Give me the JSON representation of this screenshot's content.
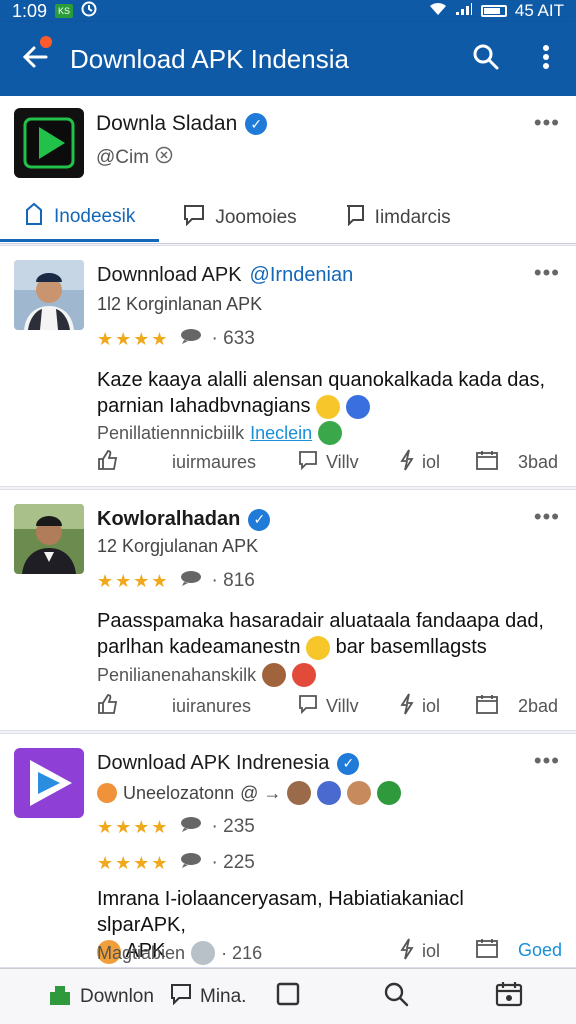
{
  "status_bar": {
    "time": "1:09",
    "badge": "KS",
    "battery_text": "45 AIT"
  },
  "app_bar": {
    "title": "Download APK Indensia"
  },
  "profile": {
    "name": "Downla Sladan",
    "handle": "@Cim",
    "more": "•••"
  },
  "tabs": [
    {
      "label": "Inodeesik",
      "icon": "bookmark-icon"
    },
    {
      "label": "Joomoies",
      "icon": "comment-icon"
    },
    {
      "label": "Iimdarcis",
      "icon": "flag-icon"
    }
  ],
  "posts": [
    {
      "title": "Downnload APK",
      "mention": "@Irndenian",
      "subtitle": "1l2 Korginlanan APK",
      "rating_count": "· 633",
      "body": "Kaze kaaya alalli alensan quanokalkada kada das, parnian Iahadbvnagians",
      "meta": "Penillatiennnicbiilk",
      "meta_link": "Ineclein",
      "actions": {
        "reply": "iuirmaures",
        "views": "Villv",
        "share": "iol",
        "save": "3bad"
      }
    },
    {
      "title": "Kowloralhadan",
      "subtitle": "12 Korgjulanan APK",
      "rating_count": "· 816",
      "body": "Paasspamaka hasaradair aluataala fandaapa dad, parlhan kadeamanestn",
      "body_tail": "bar basemllagsts",
      "meta": "Penilianenahanskilk",
      "actions": {
        "reply": "iuiranures",
        "views": "Villv",
        "share": "iol",
        "save": "2bad"
      }
    },
    {
      "title": "Download APK Indrenesia",
      "subtitle": "Uneelozatonn",
      "subtitle_at": "@ →",
      "rating_count_1": "· 235",
      "rating_count_2": "· 225",
      "body": "Imrana I-iolaanceryasam, Habiatiakaniacl slparAPK,",
      "body_tail": "APK",
      "meta": "Magtiabien",
      "meta_count": "· 216",
      "actions": {
        "share": "iol",
        "save": "Goed"
      }
    }
  ],
  "bottom_nav": {
    "item1": "Downlon",
    "item2": "Mina."
  },
  "colors": {
    "primary": "#0f5aa6",
    "accent": "#1466b8",
    "star": "#f0a81c",
    "verified": "#1f7ad8"
  }
}
